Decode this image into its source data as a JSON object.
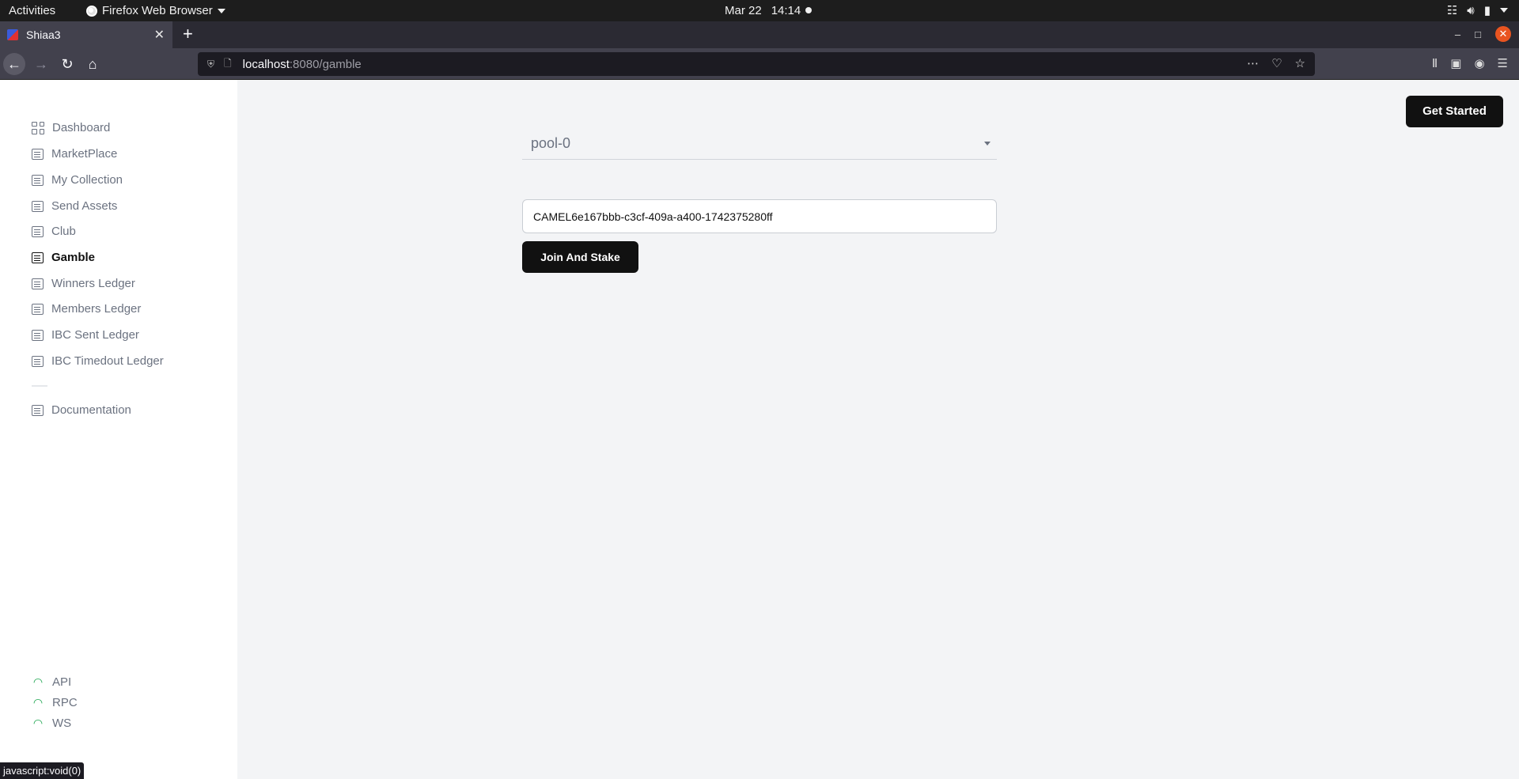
{
  "gnome": {
    "activities": "Activities",
    "app_name": "Firefox Web Browser",
    "date": "Mar 22",
    "time": "14:14"
  },
  "browser": {
    "tab_title": "Shiaa3",
    "url_host": "localhost",
    "url_rest": ":8080/gamble",
    "status_text": "javascript:void(0)"
  },
  "sidebar": {
    "items": [
      {
        "label": "Dashboard",
        "icon": "grid-icon"
      },
      {
        "label": "MarketPlace",
        "icon": "doc-icon"
      },
      {
        "label": "My Collection",
        "icon": "doc-icon"
      },
      {
        "label": "Send Assets",
        "icon": "doc-icon"
      },
      {
        "label": "Club",
        "icon": "doc-icon"
      },
      {
        "label": "Gamble",
        "icon": "doc-icon",
        "active": true
      },
      {
        "label": "Winners Ledger",
        "icon": "doc-icon"
      },
      {
        "label": "Members Ledger",
        "icon": "doc-icon"
      },
      {
        "label": "IBC Sent Ledger",
        "icon": "doc-icon"
      },
      {
        "label": "IBC Timedout Ledger",
        "icon": "doc-icon"
      }
    ],
    "documentation": "Documentation",
    "status": [
      {
        "label": "API",
        "color": "#16a34a"
      },
      {
        "label": "RPC",
        "color": "#16a34a"
      },
      {
        "label": "WS",
        "color": "#16a34a"
      }
    ]
  },
  "header": {
    "get_started": "Get Started"
  },
  "gamble": {
    "pool_selected": "pool-0",
    "stake_value": "CAMEL6e167bbb-c3cf-409a-a400-1742375280ff",
    "join_button": "Join And Stake"
  }
}
